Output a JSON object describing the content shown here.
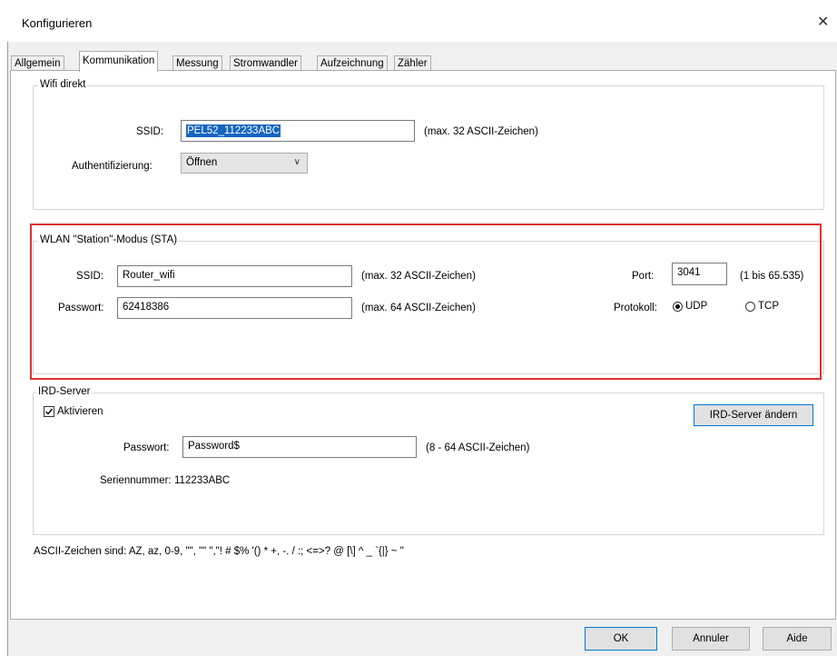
{
  "window": {
    "title": "Konfigurieren",
    "close_glyph": "✕"
  },
  "tabs": [
    {
      "label": "Allgemein",
      "active": false
    },
    {
      "label": "Kommunikation",
      "active": true
    },
    {
      "label": "Messung",
      "active": false
    },
    {
      "label": "Stromwandler",
      "active": false
    },
    {
      "label": "Aufzeichnung",
      "active": false
    },
    {
      "label": "Zähler",
      "active": false
    }
  ],
  "wifi_direkt": {
    "legend": "Wifi direkt",
    "ssid_label": "SSID:",
    "ssid_value": "PEL52_112233ABC",
    "ssid_hint": "(max. 32 ASCII-Zeichen)",
    "auth_label": "Authentifizierung:",
    "auth_value": "Öffnen"
  },
  "sta": {
    "legend": "WLAN \"Station\"-Modus (STA)",
    "ssid_label": "SSID:",
    "ssid_value": "Router_wifi",
    "ssid_hint": "(max. 32 ASCII-Zeichen)",
    "password_label": "Passwort:",
    "password_value": "62418386",
    "password_hint": "(max. 64 ASCII-Zeichen)",
    "port_label": "Port:",
    "port_value": "3041",
    "port_hint": "(1 bis 65.535)",
    "protocol_label": "Protokoll:",
    "protocol_options": [
      "UDP",
      "TCP"
    ],
    "protocol_selected": "UDP"
  },
  "ird_server": {
    "legend": "IRD-Server",
    "activate_label": "Aktivieren",
    "activate_checked": true,
    "change_button": "IRD-Server ändern",
    "password_label": "Passwort:",
    "password_value": "Password$",
    "password_hint": "(8 - 64 ASCII-Zeichen)",
    "serial_label": "Seriennummer:",
    "serial_value": "112233ABC"
  },
  "ascii_note": "ASCII-Zeichen sind: AZ, az, 0-9, \"\", \"\" \",\"! # $% '() * +, -. / :; <=>? @ [\\] ^ _ `{|} ~ \"",
  "footer": {
    "ok_label": "OK",
    "cancel_label": "Annuler",
    "help_label": "Aide"
  },
  "colors": {
    "highlight_box": "#e03030",
    "selection": "#1565c0",
    "focus": "#0078d7"
  }
}
